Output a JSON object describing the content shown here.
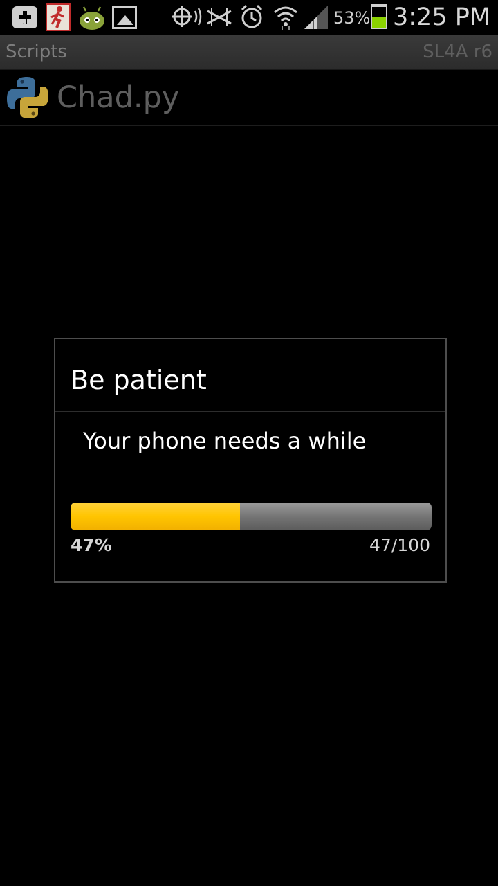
{
  "status_bar": {
    "icons": [
      "add-icon",
      "runner-app-icon",
      "android-icon",
      "gallery-icon",
      "gps-icon",
      "no-signal-icon",
      "alarm-icon",
      "wifi-icon",
      "cell-signal-icon",
      "battery-icon"
    ],
    "battery_percent_label": "53%",
    "battery_level": 0.53,
    "time": "3:25 PM",
    "battery_fill_color": "#8bd200"
  },
  "title_bar": {
    "title": "Scripts",
    "app_version": "SL4A r6"
  },
  "script_list": {
    "items": [
      {
        "icon": "python-icon",
        "name": "Chad.py"
      }
    ]
  },
  "dialog": {
    "title": "Be patient",
    "message": "Your phone needs a while",
    "progress": {
      "value": 47,
      "max": 100,
      "fraction": 0.47,
      "percent_label": "47%",
      "count_label": "47/100",
      "fill_color": "#ffc500",
      "track_color": "#7a7a7a"
    }
  }
}
